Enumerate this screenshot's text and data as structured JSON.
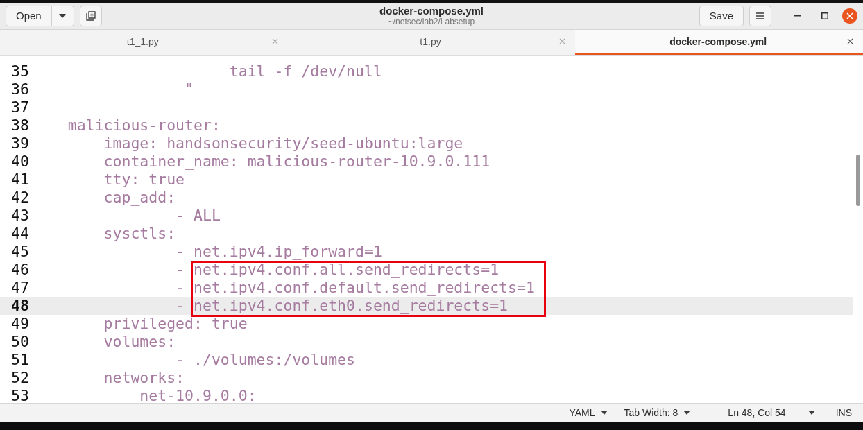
{
  "window": {
    "title": "docker-compose.yml",
    "subtitle": "~/netsec/lab2/Labsetup"
  },
  "header": {
    "open_button": "Open",
    "save_button": "Save"
  },
  "tabs": [
    {
      "label": "t1_1.py",
      "selected": false
    },
    {
      "label": "t1.py",
      "selected": false
    },
    {
      "label": "docker-compose.yml",
      "selected": true
    }
  ],
  "editor": {
    "lines": [
      {
        "number": "35",
        "text": "                      tail -f /dev/null",
        "current": false,
        "boxed": false
      },
      {
        "number": "36",
        "text": "                 \"",
        "current": false,
        "boxed": false
      },
      {
        "number": "37",
        "current": false,
        "boxed": false
      },
      {
        "number": "38",
        "text": "    malicious-router:",
        "current": false,
        "boxed": false
      },
      {
        "number": "39",
        "text": "        image: handsonsecurity/seed-ubuntu:large",
        "current": false,
        "boxed": false
      },
      {
        "number": "40",
        "text": "        container_name: malicious-router-10.9.0.111",
        "current": false,
        "boxed": false
      },
      {
        "number": "41",
        "text": "        tty: true",
        "current": false,
        "boxed": false
      },
      {
        "number": "42",
        "text": "        cap_add:",
        "current": false,
        "boxed": false
      },
      {
        "number": "43",
        "text": "                - ALL",
        "current": false,
        "boxed": false
      },
      {
        "number": "44",
        "text": "        sysctls:",
        "current": false,
        "boxed": false
      },
      {
        "number": "45",
        "text": "                - net.ipv4.ip_forward=1",
        "current": false,
        "boxed": false
      },
      {
        "number": "46",
        "text": "                - net.ipv4.conf.all.send_redirects=1",
        "current": false,
        "boxed": true
      },
      {
        "number": "47",
        "text": "                - net.ipv4.conf.default.send_redirects=1",
        "current": false,
        "boxed": true
      },
      {
        "number": "48",
        "text": "                - net.ipv4.conf.eth0.send_redirects=1",
        "current": true,
        "boxed": true
      },
      {
        "number": "49",
        "text": "        privileged: true",
        "current": false,
        "boxed": false
      },
      {
        "number": "50",
        "text": "        volumes:",
        "current": false,
        "boxed": false
      },
      {
        "number": "51",
        "text": "                - ./volumes:/volumes",
        "current": false,
        "boxed": false
      },
      {
        "number": "52",
        "text": "        networks:",
        "current": false,
        "boxed": false
      },
      {
        "number": "53",
        "text": "            net-10.9.0.0:",
        "current": false,
        "boxed": false
      }
    ]
  },
  "status_bar": {
    "language": "YAML",
    "tab_width": "Tab Width: 8",
    "position": "Ln 48, Col 54",
    "mode": "INS"
  }
}
